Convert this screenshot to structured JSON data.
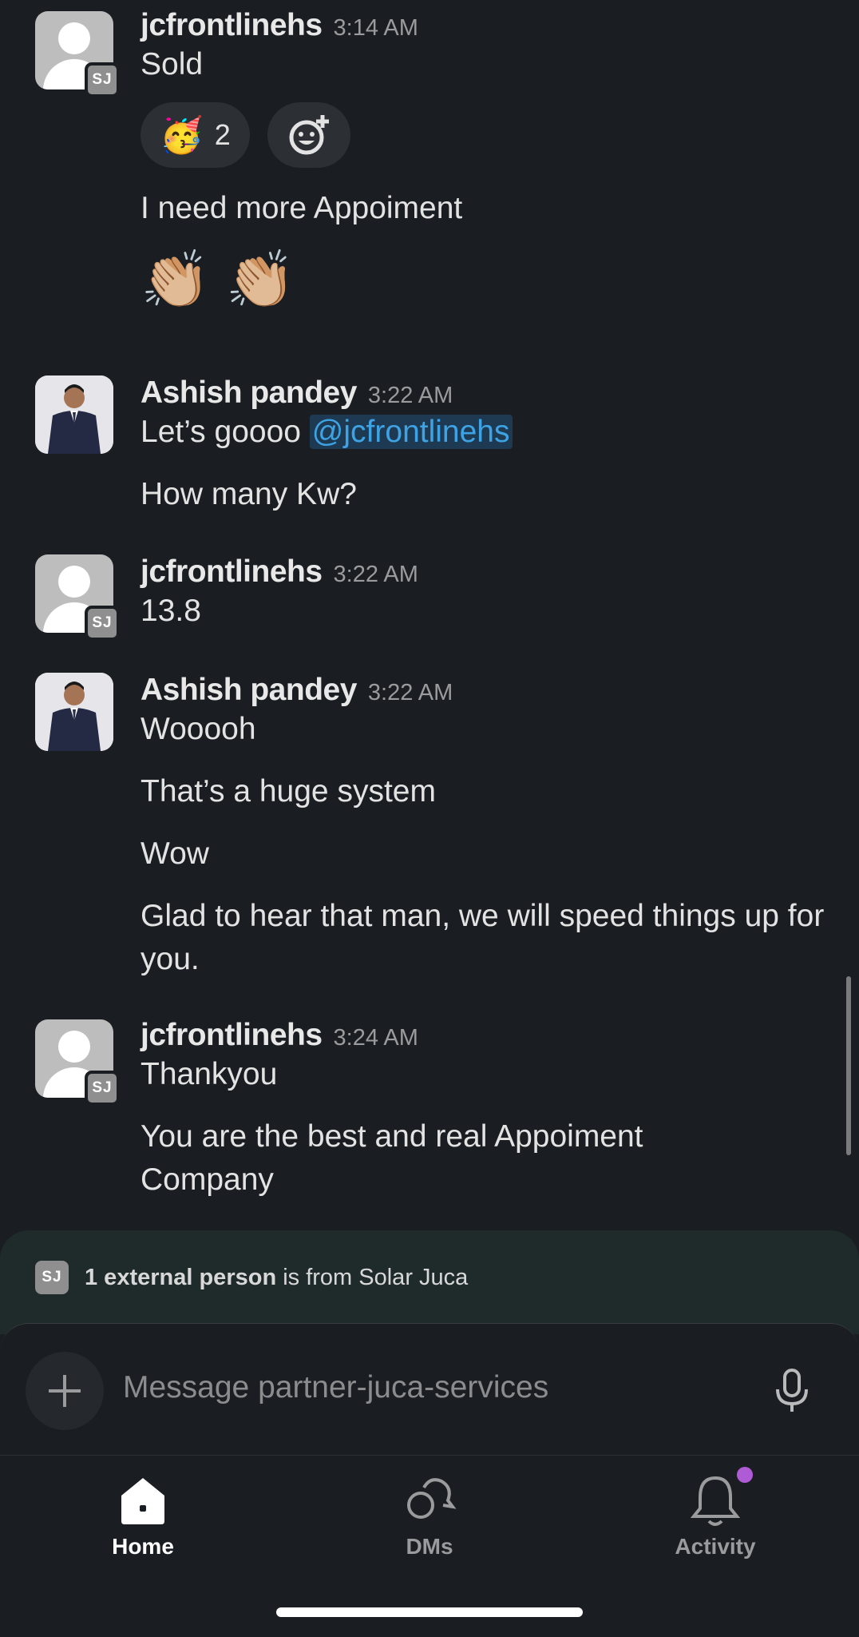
{
  "messages": [
    {
      "author": "jcfrontlinehs",
      "time": "3:14 AM",
      "avatar": "default",
      "badge": "SJ",
      "lines": [
        "Sold"
      ],
      "reactions": [
        {
          "emoji": "🥳",
          "count": "2"
        }
      ],
      "after_lines": [
        "I need more Appoiment"
      ],
      "emoji_line": "👏🏼 👏🏼"
    },
    {
      "author": "Ashish pandey",
      "time": "3:22 AM",
      "avatar": "photo",
      "line1_prefix": "Let’s goooo ",
      "mention": "@jcfrontlinehs",
      "lines": [
        "How many Kw?"
      ]
    },
    {
      "author": "jcfrontlinehs",
      "time": "3:22 AM",
      "avatar": "default",
      "badge": "SJ",
      "lines": [
        "13.8"
      ]
    },
    {
      "author": "Ashish pandey",
      "time": "3:22 AM",
      "avatar": "photo",
      "lines": [
        "Wooooh",
        "That’s a huge system",
        "Wow",
        "Glad to hear that man, we will speed things up for you."
      ]
    },
    {
      "author": "jcfrontlinehs",
      "time": "3:24 AM",
      "avatar": "default",
      "badge": "SJ",
      "lines": [
        "Thankyou",
        "You are the best and real Appoiment Company"
      ]
    }
  ],
  "external": {
    "badge": "SJ",
    "bold": "1 external person",
    "rest": " is from Solar Juca"
  },
  "composer": {
    "placeholder": "Message partner-juca-services"
  },
  "tabs": [
    {
      "label": "Home",
      "icon": "home-icon",
      "active": true
    },
    {
      "label": "DMs",
      "icon": "dms-icon",
      "active": false
    },
    {
      "label": "Activity",
      "icon": "bell-icon",
      "active": false
    }
  ],
  "colors": {
    "background": "#1a1d21",
    "mention": "#3ea3e4",
    "activity_dot": "#b05bd6"
  }
}
